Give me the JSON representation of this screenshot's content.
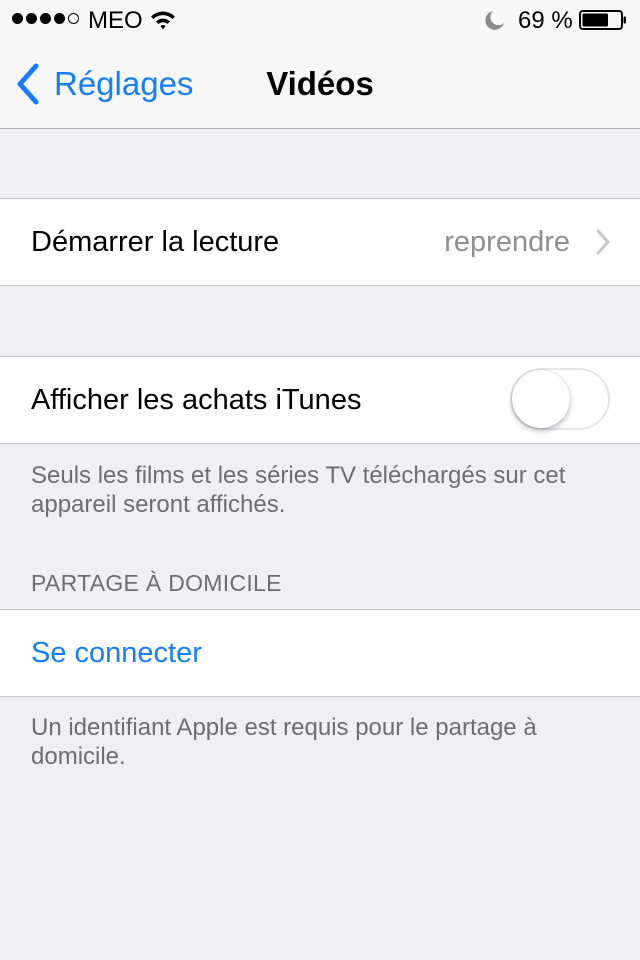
{
  "status_bar": {
    "signal_dots_filled": 4,
    "signal_dots_total": 5,
    "carrier": "MEO",
    "wifi_icon": "wifi-icon",
    "do_not_disturb_icon": "moon-icon",
    "battery_percent_text": "69 %",
    "battery_level": 0.69
  },
  "nav": {
    "back_label": "Réglages",
    "back_icon": "chevron-left-icon",
    "title": "Vidéos"
  },
  "playback": {
    "label": "Démarrer la lecture",
    "value": "reprendre",
    "chevron_icon": "chevron-right-icon"
  },
  "itunes": {
    "label": "Afficher les achats iTunes",
    "toggle_on": false,
    "footer": "Seuls les films et les séries TV téléchargés sur cet appareil seront affichés."
  },
  "home_sharing": {
    "header": "PARTAGE À DOMICILE",
    "connect_label": "Se connecter",
    "footer": "Un identifiant Apple est requis pour le partage à domicile."
  },
  "colors": {
    "accent": "#157efb",
    "background": "#efeff4",
    "secondary_text": "#8e8e93",
    "footer_text": "#6d6d72"
  }
}
